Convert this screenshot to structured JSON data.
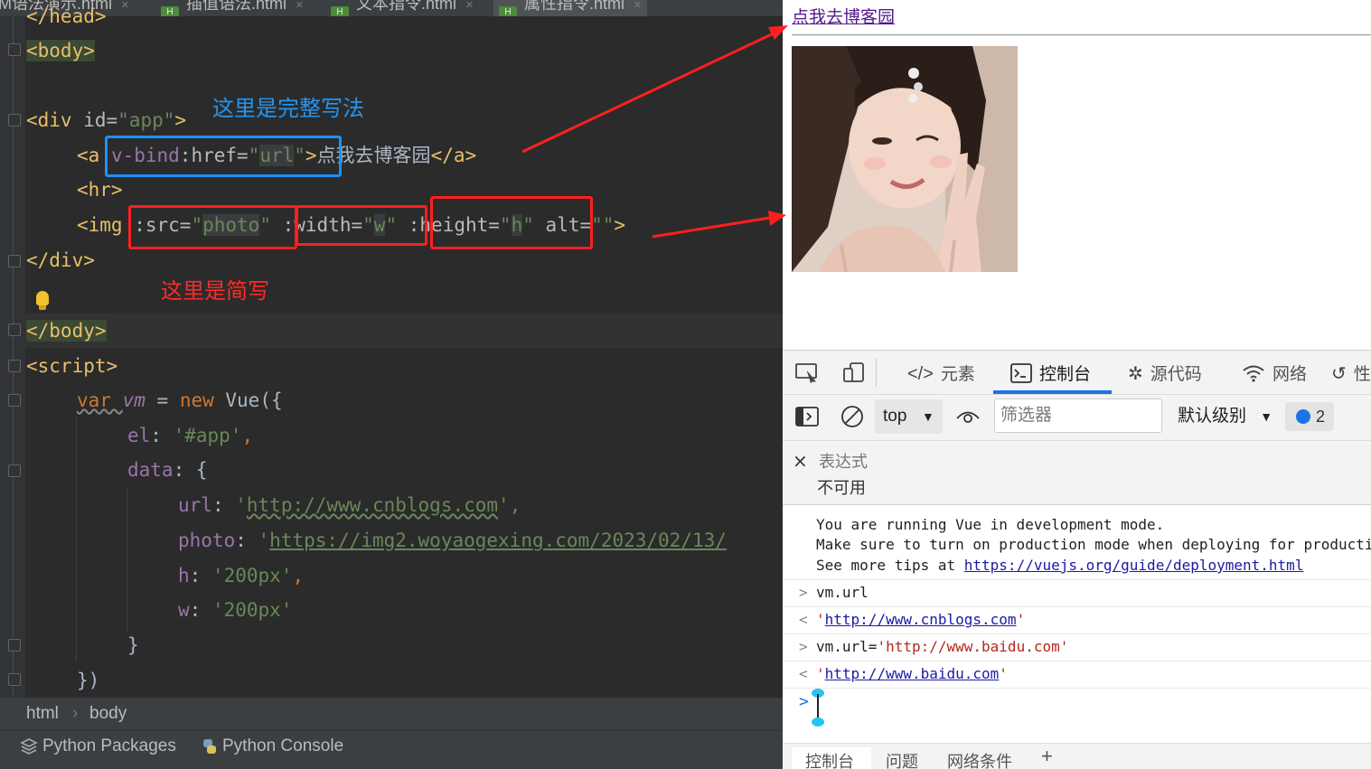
{
  "editor": {
    "tabs": [
      {
        "label": "M语法演示.html",
        "active": false
      },
      {
        "label": "插值语法.html",
        "active": false
      },
      {
        "label": "文本指令.html",
        "active": false
      },
      {
        "label": "属性指令.html",
        "active": true
      }
    ],
    "file_icon": "html-file-icon",
    "annotation_full": "这里是完整写法",
    "annotation_short": "这里是简写",
    "code": {
      "head_close": "</head>",
      "body_open": "<body>",
      "div_open": {
        "tag": "<div ",
        "attr": "id=",
        "val": "\"app\"",
        "end": ">"
      },
      "a_line": {
        "open": "<a ",
        "attr1": "v-bind",
        "attr2": ":href=",
        "val_q1": "\"",
        "val": "url",
        "val_q2": "\"",
        "end": ">",
        "text": "点我去博客园",
        "close": "</a>"
      },
      "hr_line": "<hr>",
      "img_line": {
        "open": "<img ",
        "src_attr": ":src=",
        "src_q": "\"",
        "src_val": "photo",
        "width_attr": ":width=",
        "width_val": "w",
        "height_attr": ":height=",
        "height_val": "h",
        "alt_attr": "alt=",
        "alt_val": "\"\"",
        "end": ">"
      },
      "div_close": "</div>",
      "body_close": "</body>",
      "script_open": "<script>",
      "vm_line": {
        "kw": "var ",
        "var": "vm",
        "eq": " = ",
        "new": "new ",
        "fn": "Vue",
        "end": "({"
      },
      "el_line": {
        "key": "el",
        "colon": ": ",
        "val": "'#app'",
        "comma": ","
      },
      "data_line": {
        "key": "data",
        "rest": ": {"
      },
      "url_line": {
        "key": "url",
        "colon": ": ",
        "q": "'",
        "val": "http://www.cnblogs.com",
        "end": "',"
      },
      "photo_line": {
        "key": "photo",
        "colon": ": ",
        "q": "'",
        "val": "https://img2.woyaogexing.com/2023/02/13/"
      },
      "h_line": {
        "key": "h",
        "colon": ": ",
        "val": "'200px'",
        "comma": ","
      },
      "w_line": {
        "key": "w",
        "colon": ": ",
        "val": "'200px'"
      },
      "brace_close": "}",
      "paren_close": "})"
    },
    "breadcrumb": [
      "html",
      "body"
    ],
    "bottom_tools": [
      {
        "label": "Python Packages",
        "icon": "layers-icon"
      },
      {
        "label": "Python Console",
        "icon": "python-icon"
      }
    ]
  },
  "browser": {
    "link_text": "点我去博客园",
    "photo_alt": "",
    "devtools": {
      "tabs": [
        {
          "label": "元素",
          "icon": "code-brackets-icon",
          "active": false
        },
        {
          "label": "控制台",
          "icon": "console-icon",
          "active": true
        },
        {
          "label": "源代码",
          "icon": "bug-icon",
          "active": false
        },
        {
          "label": "网络",
          "icon": "wifi-icon",
          "active": false
        },
        {
          "label": "性",
          "icon": "performance-icon",
          "active": false
        }
      ],
      "context": "top",
      "filter_placeholder": "筛选器",
      "level": "默认级别",
      "issues_count": "2",
      "live_expression": {
        "title": "表达式",
        "value": "不可用"
      },
      "console": {
        "warn_lines": [
          "You are running Vue in development mode.",
          "Make sure to turn on production mode when deploying for production.",
          "See more tips at "
        ],
        "warn_link": "https://vuejs.org/guide/deployment.html",
        "entries": [
          {
            "dir": ">",
            "text": "vm.url"
          },
          {
            "dir": "<",
            "q": "'",
            "link": "http://www.cnblogs.com"
          },
          {
            "dir": ">",
            "text": "vm.url=",
            "str": "'http://www.baidu.com'"
          },
          {
            "dir": "<",
            "q": "'",
            "link": "http://www.baidu.com"
          }
        ],
        "prompt": ">"
      },
      "drawer_tabs": [
        "控制台",
        "问题",
        "网络条件",
        "+"
      ]
    }
  }
}
